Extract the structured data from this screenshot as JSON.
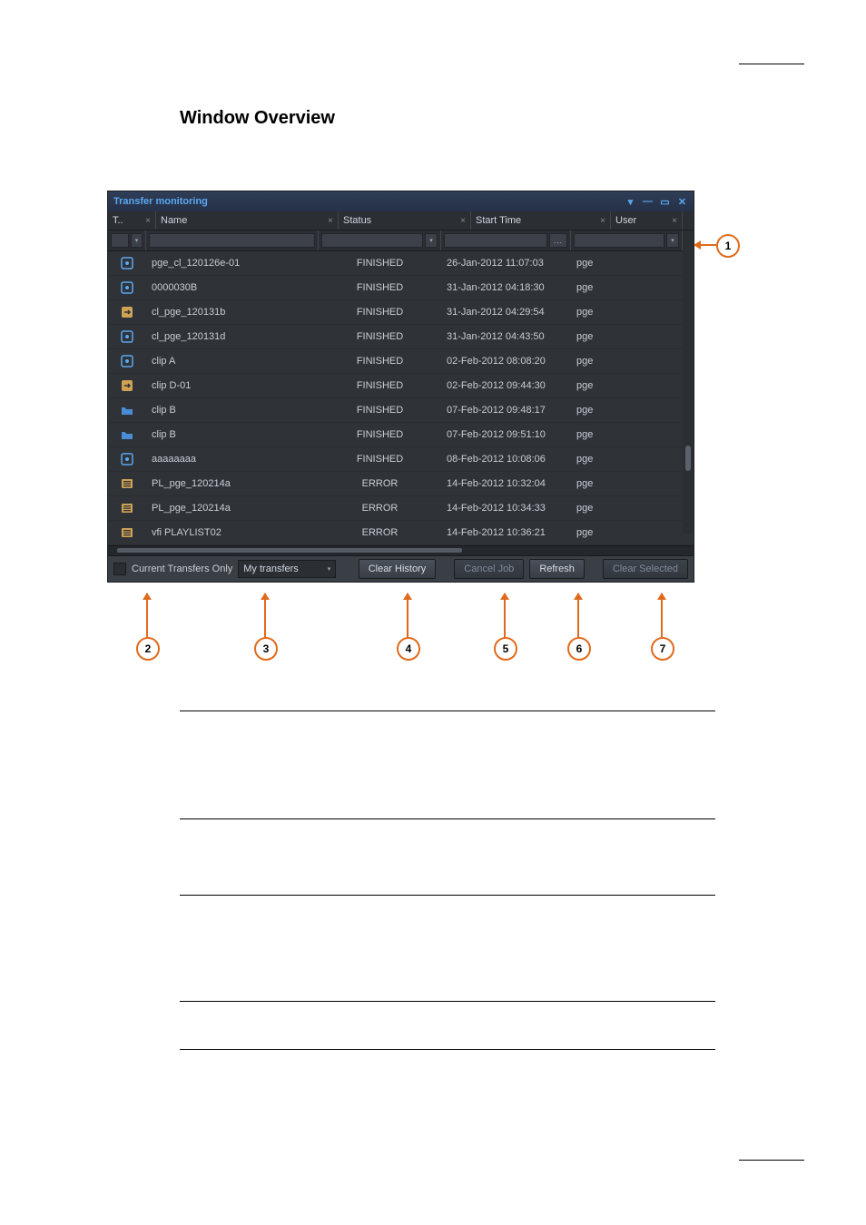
{
  "page": {
    "heading": "Window Overview"
  },
  "window": {
    "title": "Transfer monitoring",
    "columns": [
      {
        "key": "type",
        "label": "T.."
      },
      {
        "key": "name",
        "label": "Name"
      },
      {
        "key": "status",
        "label": "Status"
      },
      {
        "key": "start",
        "label": "Start Time"
      },
      {
        "key": "user",
        "label": "User"
      }
    ],
    "rows": [
      {
        "icon": "import-blue",
        "name": "pge_cl_120126e-01",
        "status": "FINISHED",
        "start": "26-Jan-2012 11:07:03",
        "user": "pge"
      },
      {
        "icon": "import-blue",
        "name": "0000030B",
        "status": "FINISHED",
        "start": "31-Jan-2012 04:18:30",
        "user": "pge"
      },
      {
        "icon": "export-tan",
        "name": "cl_pge_120131b",
        "status": "FINISHED",
        "start": "31-Jan-2012 04:29:54",
        "user": "pge"
      },
      {
        "icon": "import-blue",
        "name": "cl_pge_120131d",
        "status": "FINISHED",
        "start": "31-Jan-2012 04:43:50",
        "user": "pge"
      },
      {
        "icon": "import-blue",
        "name": "clip A",
        "status": "FINISHED",
        "start": "02-Feb-2012 08:08:20",
        "user": "pge"
      },
      {
        "icon": "export-tan",
        "name": "clip D-01",
        "status": "FINISHED",
        "start": "02-Feb-2012 09:44:30",
        "user": "pge"
      },
      {
        "icon": "folder-blue",
        "name": "clip B",
        "status": "FINISHED",
        "start": "07-Feb-2012 09:48:17",
        "user": "pge"
      },
      {
        "icon": "folder-blue",
        "name": "clip B",
        "status": "FINISHED",
        "start": "07-Feb-2012 09:51:10",
        "user": "pge"
      },
      {
        "icon": "import-blue",
        "name": "aaaaaaaa",
        "status": "FINISHED",
        "start": "08-Feb-2012 10:08:06",
        "user": "pge"
      },
      {
        "icon": "playlist-tan",
        "name": "PL_pge_120214a",
        "status": "ERROR",
        "start": "14-Feb-2012 10:32:04",
        "user": "pge"
      },
      {
        "icon": "playlist-tan",
        "name": "PL_pge_120214a",
        "status": "ERROR",
        "start": "14-Feb-2012 10:34:33",
        "user": "pge"
      },
      {
        "icon": "playlist-tan",
        "name": "vfi PLAYLIST02",
        "status": "ERROR",
        "start": "14-Feb-2012 10:36:21",
        "user": "pge"
      }
    ],
    "bottombar": {
      "current_only_label": "Current Transfers Only",
      "dropdown_value": "My transfers",
      "clear_history": "Clear History",
      "cancel_job": "Cancel Job",
      "refresh": "Refresh",
      "clear_selected": "Clear Selected"
    }
  },
  "callouts": {
    "c1": "1",
    "c2": "2",
    "c3": "3",
    "c4": "4",
    "c5": "5",
    "c6": "6",
    "c7": "7"
  },
  "icons": {
    "import-blue": "#5aa7f0",
    "export-tan": "#cfa254",
    "folder-blue": "#4a8bd6",
    "playlist-tan": "#cfa254"
  }
}
